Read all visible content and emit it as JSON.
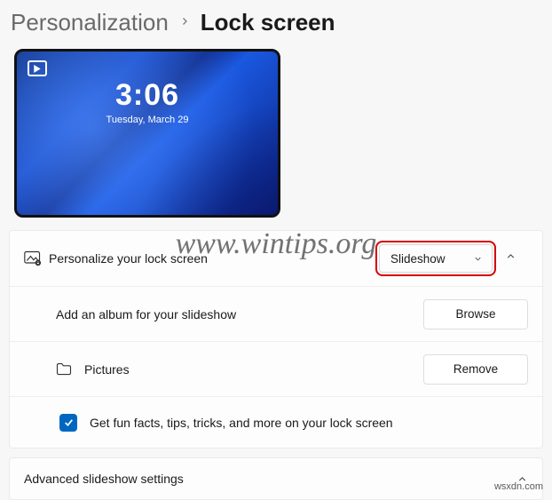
{
  "breadcrumb": {
    "parent": "Personalization",
    "current": "Lock screen"
  },
  "preview": {
    "time": "3:06",
    "date": "Tuesday, March 29"
  },
  "personalize": {
    "label": "Personalize your lock screen",
    "select_value": "Slideshow"
  },
  "album": {
    "label": "Add an album for your slideshow",
    "button": "Browse"
  },
  "folder": {
    "label": "Pictures",
    "button": "Remove"
  },
  "funfacts": {
    "label": "Get fun facts, tips, tricks, and more on your lock screen",
    "checked": true
  },
  "advanced": {
    "label": "Advanced slideshow settings"
  },
  "watermark_main": "www.wintips.org",
  "watermark_corner": "wsxdn.com"
}
